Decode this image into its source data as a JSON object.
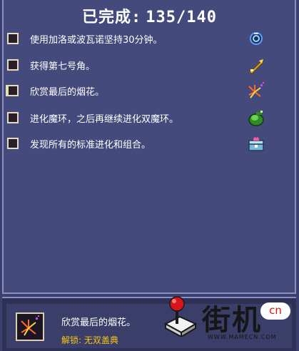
{
  "header": {
    "label": "已完成:",
    "progress_text": "135/140",
    "completed": 135,
    "total": 140
  },
  "achievements": [
    {
      "text": "使用加洛或波瓦诺坚持30分钟。",
      "icon": "ring-icon",
      "checked": false
    },
    {
      "text": "获得第七号角。",
      "icon": "horn-icon",
      "checked": false
    },
    {
      "text": "欣赏最后的烟花。",
      "icon": "firework-icon",
      "checked": false,
      "selected": true
    },
    {
      "text": "进化魔环，之后再继续进化双魔环。",
      "icon": "green-orb-icon",
      "checked": false
    },
    {
      "text": "发现所有的标准进化和组合。",
      "icon": "chest-icon",
      "checked": false
    }
  ],
  "selected": {
    "description": "欣赏最后的烟花。",
    "unlock_label": "解锁:",
    "unlock_value": "无双盖典",
    "icon": "firework-icon"
  },
  "watermark": {
    "brand": "街机",
    "badge": "cn",
    "site": "WWW.MAMECN.COM"
  },
  "colors": {
    "background": "#3b3f6e",
    "panel": "#444a7c",
    "unlock_text": "#f5c518"
  }
}
